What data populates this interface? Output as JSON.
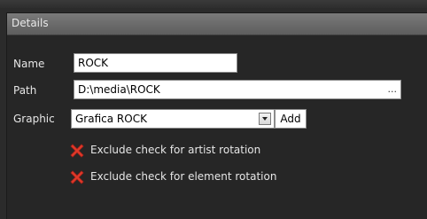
{
  "panel": {
    "title": "Details"
  },
  "form": {
    "name_label": "Name",
    "name_value": "ROCK",
    "path_label": "Path",
    "path_value": "D:\\media\\ROCK",
    "browse_label": "...",
    "graphic_label": "Graphic",
    "graphic_selected": "Grafica ROCK",
    "add_label": "Add"
  },
  "checks": [
    {
      "label": "Exclude check for artist rotation",
      "icon": "red-x-icon",
      "checked": false
    },
    {
      "label": "Exclude check for element rotation",
      "icon": "red-x-icon",
      "checked": false
    }
  ],
  "colors": {
    "background": "#2b2b2b",
    "header": "#6b6b6b",
    "x_red": "#e03a2a"
  }
}
